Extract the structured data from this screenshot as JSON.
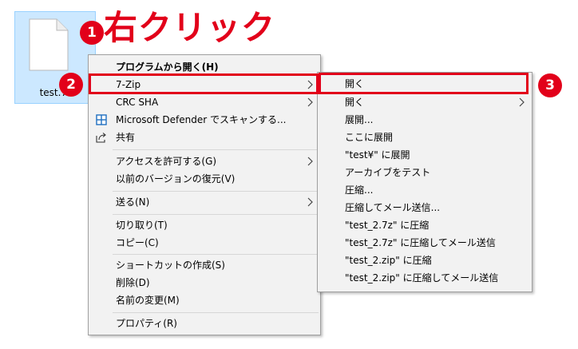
{
  "desktop": {
    "file_label": "test.7z"
  },
  "annotations": {
    "step1": "1",
    "step1_title": "右クリック",
    "step2": "2",
    "step3": "3"
  },
  "context_menu": {
    "items": [
      {
        "label": "プログラムから開く(H)",
        "bold": true
      },
      {
        "label": "7-Zip",
        "submenu": true
      },
      {
        "label": "CRC SHA",
        "submenu": true
      },
      {
        "label": "Microsoft Defender でスキャンする...",
        "icon": "defender-shield-icon"
      },
      {
        "label": "共有",
        "icon": "share-icon"
      },
      {
        "label": "アクセスを許可する(G)",
        "submenu": true
      },
      {
        "label": "以前のバージョンの復元(V)"
      },
      {
        "label": "送る(N)",
        "submenu": true
      },
      {
        "label": "切り取り(T)"
      },
      {
        "label": "コピー(C)"
      },
      {
        "label": "ショートカットの作成(S)"
      },
      {
        "label": "削除(D)"
      },
      {
        "label": "名前の変更(M)"
      },
      {
        "label": "プロパティ(R)"
      }
    ]
  },
  "submenu_7zip": {
    "items": [
      {
        "label": "開く"
      },
      {
        "label": "開く",
        "submenu": true
      },
      {
        "label": "展開..."
      },
      {
        "label": "ここに展開"
      },
      {
        "label": "\"test¥\" に展開"
      },
      {
        "label": "アーカイブをテスト"
      },
      {
        "label": "圧縮..."
      },
      {
        "label": "圧縮してメール送信..."
      },
      {
        "label": "\"test_2.7z\" に圧縮"
      },
      {
        "label": "\"test_2.7z\" に圧縮してメール送信"
      },
      {
        "label": "\"test_2.zip\" に圧縮"
      },
      {
        "label": "\"test_2.zip\" に圧縮してメール送信"
      }
    ]
  },
  "colors": {
    "accent_red": "#e2001a",
    "menu_bg": "#f2f2f2",
    "selection": "#cce8ff"
  }
}
